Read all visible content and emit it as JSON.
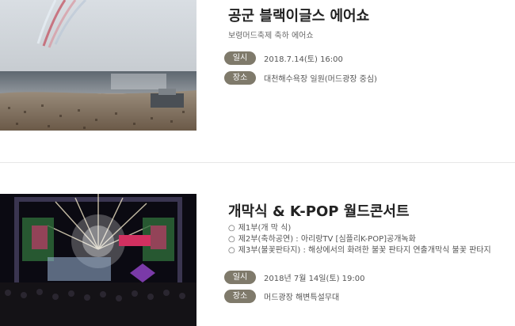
{
  "events": [
    {
      "title": "공군 블랙이글스 에어쇼",
      "subtitle": "보령머드축제 축하 에어쇼",
      "info": [
        {
          "label": "일시",
          "value": "2018.7.14(토) 16:00"
        },
        {
          "label": "장소",
          "value": "대천해수욕장 일원(머드광장 중심)"
        }
      ]
    },
    {
      "title": "개막식 & K-POP 월드콘서트",
      "program_bullet": "○",
      "program": [
        "제1부(개 막 식)",
        "제2부(축하공연) : 아리랑TV [심플리K-POP]공개녹화",
        "제3부(불꽃판타지) : 해상에서의 화려한 불꽃 판타지 연출개막식 불꽃 판타지"
      ],
      "info": [
        {
          "label": "일시",
          "value": "2018년 7월 14일(토) 19:00"
        },
        {
          "label": "장소",
          "value": "머드광장 해변특설무대"
        }
      ]
    }
  ]
}
